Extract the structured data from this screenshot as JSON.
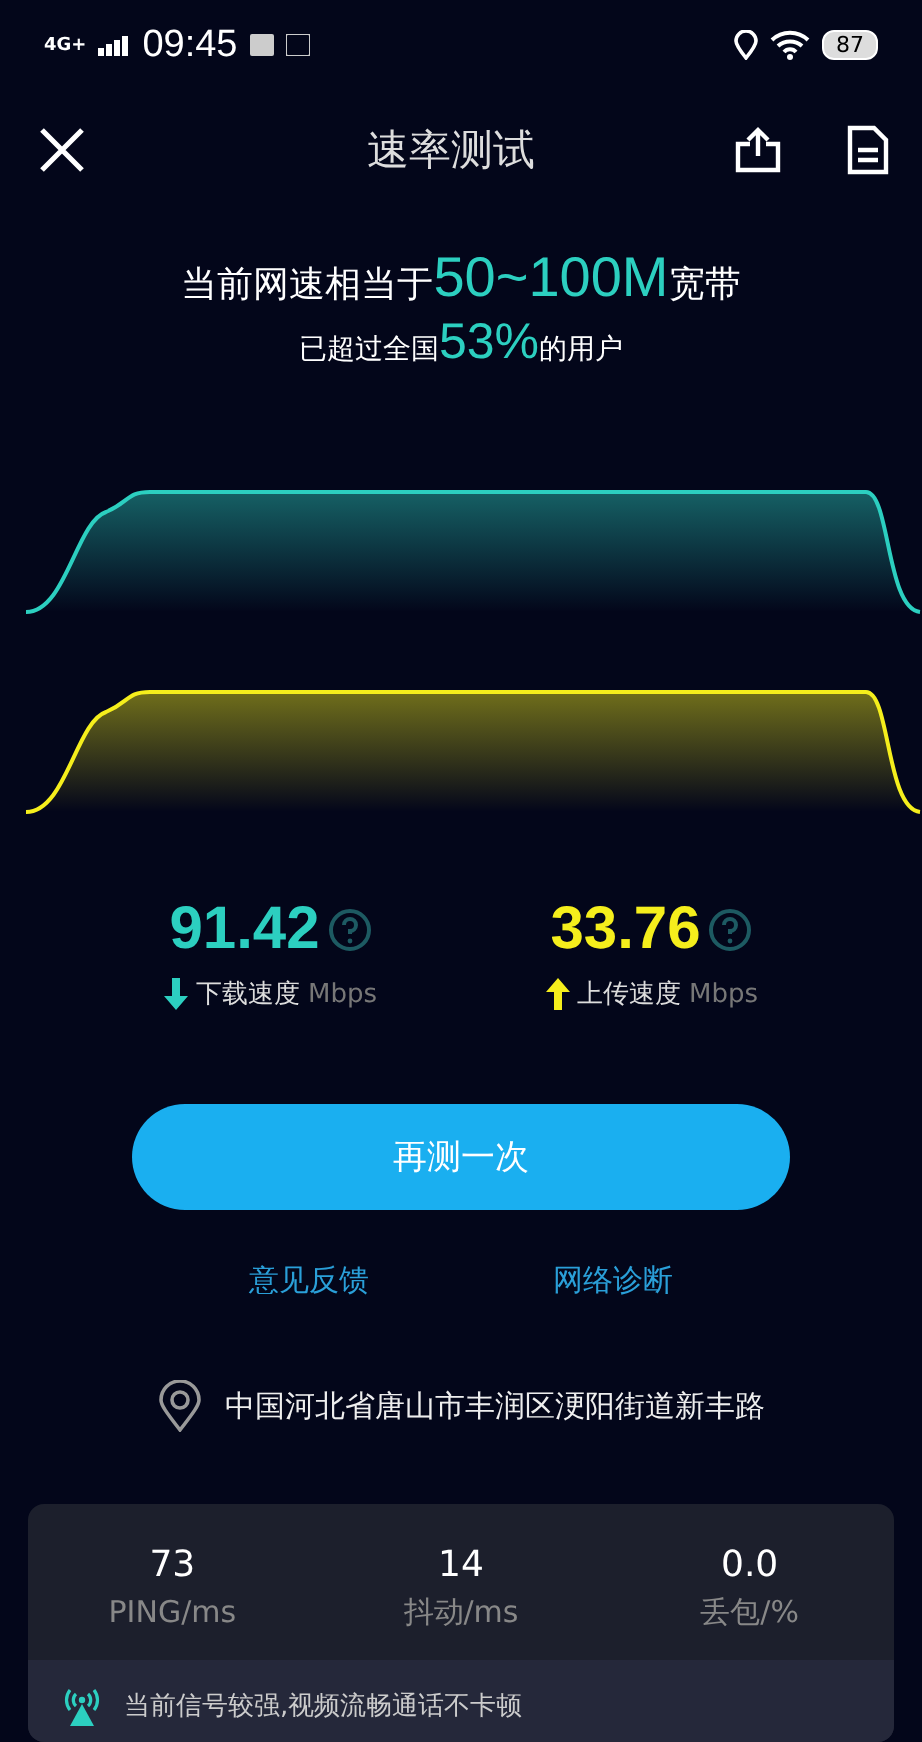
{
  "status_bar": {
    "network": "4G+",
    "time": "09:45",
    "battery": "87"
  },
  "header": {
    "title": "速率测试"
  },
  "summary": {
    "line1": {
      "before": "当前网速相当于",
      "highlight": "50~100M",
      "after": "宽带"
    },
    "line2": {
      "before": "已超过全国",
      "highlight": "53%",
      "after": "的用户"
    }
  },
  "results": [
    {
      "kind": "download",
      "value": "91.42",
      "label": "下载速度",
      "unit": "Mbps",
      "color": "#2ccfc0"
    },
    {
      "kind": "upload",
      "value": "33.76",
      "label": "上传速度",
      "unit": "Mbps",
      "color": "#f5ee1c"
    }
  ],
  "retest_button": "再测一次",
  "links": [
    "意见反馈",
    "网络诊断"
  ],
  "location": "中国河北省唐山市丰润区浭阳街道新丰路",
  "stats": [
    {
      "value": "73",
      "label": "PING/ms"
    },
    {
      "value": "14",
      "label": "抖动/ms"
    },
    {
      "value": "0.0",
      "label": "丢包/%"
    }
  ],
  "signal_note": "当前信号较强,视频流畅通话不卡顿"
}
